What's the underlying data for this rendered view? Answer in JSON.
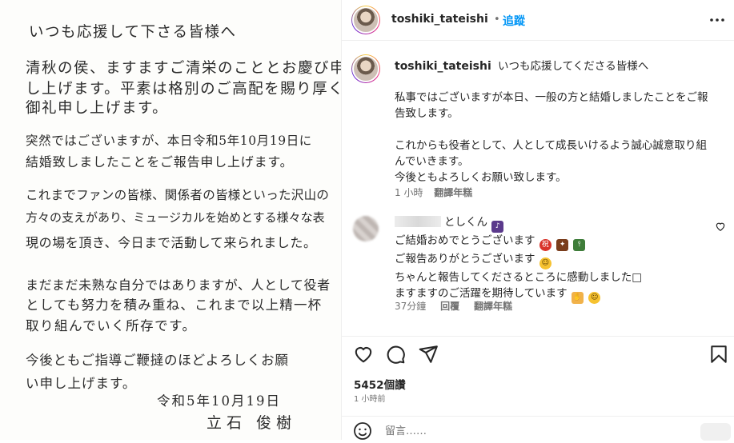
{
  "letter": {
    "lines": [
      "いつも応援して下さる皆様へ",
      "清秋の侯、ますますご清栄のこととお慶び申",
      "し上げます。平素は格別のご高配を賜り厚く",
      "御礼申し上げます。",
      "突然ではございますが、本日令和5年10月19日に",
      "結婚致しましたことをご報告申し上げます。",
      "これまでファンの皆様、関係者の皆様といった沢山の",
      "方々の支えがあり、ミュージカルを始めとする様々な表",
      "現の場を頂き、今日まで活動して来られました。",
      "まだまだ未熟な自分ではありますが、人として役者",
      "としても努力を積み重ね、これまで以上精一杯",
      "取り組んでいく所存です。",
      "今後ともご指導ご鞭撻のほどよろしくお願",
      "い申し上げます。"
    ],
    "date": "令和5年10月19日",
    "signature": "立石 俊樹"
  },
  "header": {
    "username": "toshiki_tateishi",
    "dot": "•",
    "follow_label": "追蹤",
    "more_icon": "more-horizontal-icon"
  },
  "caption": {
    "username": "toshiki_tateishi",
    "title": "いつも応援してくださる皆様へ",
    "paragraphs": [
      "私事ではございますが本日、一般の方と結婚しましたことをご報告致します。",
      "これからも役者として、人として成長いけるよう誠心誠意取り組んでいきます。",
      "今後ともよろしくお願い致します。"
    ],
    "time": "1 小時",
    "translate": "翻譯年糕"
  },
  "comment": {
    "name_suffix": "としくん",
    "lines": [
      "ご結婚おめでとうございます",
      "ご報告ありがとうございます",
      "ちゃんと報告してくださるところに感動しました□",
      "ますますのご活躍を期待しています"
    ],
    "time": "37分鐘",
    "reply": "回覆",
    "translate": "翻譯年糕"
  },
  "stats": {
    "views": "5452個讚",
    "posted": "1 小時前"
  },
  "composer": {
    "placeholder": "留言……"
  },
  "colors": {
    "link": "#0095f6",
    "muted": "#737373",
    "text": "#262626"
  }
}
